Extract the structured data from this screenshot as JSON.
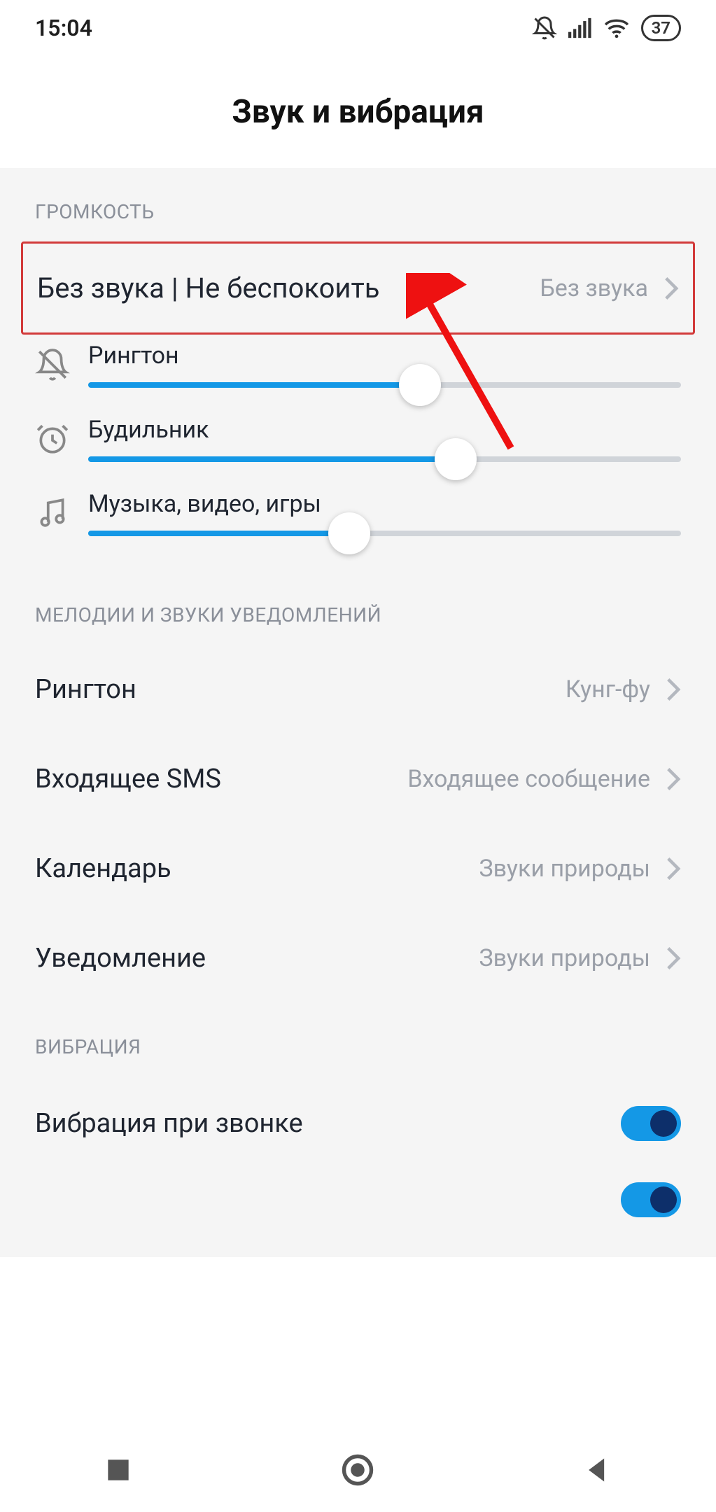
{
  "statusbar": {
    "time": "15:04",
    "battery": "37"
  },
  "header": {
    "title": "Звук и вибрация"
  },
  "sections": {
    "volume": {
      "label": "ГРОМКОСТЬ",
      "dnd_row": {
        "label": "Без звука | Не беспокоить",
        "value": "Без звука"
      },
      "sliders": [
        {
          "label": "Рингтон",
          "pct": 56
        },
        {
          "label": "Будильник",
          "pct": 62
        },
        {
          "label": "Музыка, видео, игры",
          "pct": 44
        }
      ]
    },
    "melodies": {
      "label": "МЕЛОДИИ И ЗВУКИ УВЕДОМЛЕНИЙ",
      "rows": [
        {
          "label": "Рингтон",
          "value": "Кунг-фу"
        },
        {
          "label": "Входящее SMS",
          "value": "Входящее сообщение"
        },
        {
          "label": "Календарь",
          "value": "Звуки природы"
        },
        {
          "label": "Уведомление",
          "value": "Звуки природы"
        }
      ]
    },
    "vibration": {
      "label": "ВИБРАЦИЯ",
      "rows": [
        {
          "label": "Вибрация при звонке",
          "enabled": true
        }
      ]
    }
  }
}
